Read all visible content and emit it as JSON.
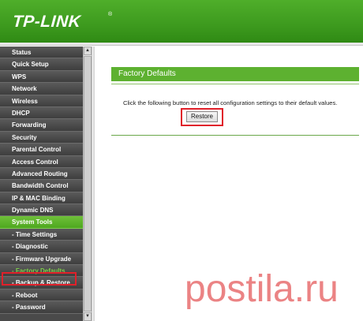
{
  "header": {
    "brand": "TP-LINK",
    "registered": "®"
  },
  "sidebar": {
    "items": [
      {
        "label": "Status",
        "name": "sidebar-item-status"
      },
      {
        "label": "Quick Setup",
        "name": "sidebar-item-quick-setup"
      },
      {
        "label": "WPS",
        "name": "sidebar-item-wps"
      },
      {
        "label": "Network",
        "name": "sidebar-item-network"
      },
      {
        "label": "Wireless",
        "name": "sidebar-item-wireless"
      },
      {
        "label": "DHCP",
        "name": "sidebar-item-dhcp"
      },
      {
        "label": "Forwarding",
        "name": "sidebar-item-forwarding"
      },
      {
        "label": "Security",
        "name": "sidebar-item-security"
      },
      {
        "label": "Parental Control",
        "name": "sidebar-item-parental-control"
      },
      {
        "label": "Access Control",
        "name": "sidebar-item-access-control"
      },
      {
        "label": "Advanced Routing",
        "name": "sidebar-item-advanced-routing"
      },
      {
        "label": "Bandwidth Control",
        "name": "sidebar-item-bandwidth-control"
      },
      {
        "label": "IP & MAC Binding",
        "name": "sidebar-item-ip-mac-binding"
      },
      {
        "label": "Dynamic DNS",
        "name": "sidebar-item-dynamic-dns"
      },
      {
        "label": "System Tools",
        "name": "sidebar-item-system-tools"
      },
      {
        "label": "- Time Settings",
        "name": "sidebar-subitem-time-settings"
      },
      {
        "label": "- Diagnostic",
        "name": "sidebar-subitem-diagnostic"
      },
      {
        "label": "- Firmware Upgrade",
        "name": "sidebar-subitem-firmware-upgrade"
      },
      {
        "label": "- Factory Defaults",
        "name": "sidebar-subitem-factory-defaults"
      },
      {
        "label": "- Backup & Restore",
        "name": "sidebar-subitem-backup-restore"
      },
      {
        "label": "- Reboot",
        "name": "sidebar-subitem-reboot"
      },
      {
        "label": "- Password",
        "name": "sidebar-subitem-password"
      }
    ],
    "scroll_up_glyph": "▲",
    "scroll_down_glyph": "▼"
  },
  "main": {
    "title": "Factory Defaults",
    "description": "Click the following button to reset all configuration settings to their default values.",
    "restore_label": "Restore"
  },
  "watermark": {
    "text": "postila.ru"
  },
  "colors": {
    "brand_green": "#4fae2a",
    "title_green": "#5db130",
    "highlight_red": "#e0202a",
    "sidebar_bg": "#4a4a4a",
    "watermark_pink": "#e86d6f"
  }
}
